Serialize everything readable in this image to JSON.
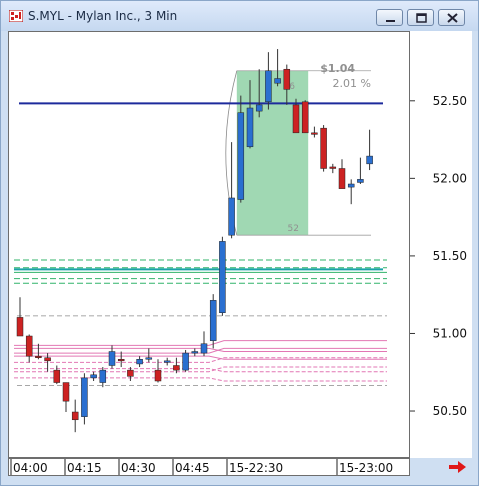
{
  "window": {
    "title": "S.MYL - Mylan Inc., 3 Min",
    "buttons": {
      "minimize": "minimize-icon",
      "restore": "restore-icon",
      "close": "close-icon"
    }
  },
  "colors": {
    "up_candle": "#2a6fd0",
    "down_candle": "#cc2222",
    "horizontal_line": "#1d2a9c",
    "measure_box": "#8fd1a6",
    "green_band": "#31b36a",
    "teal_line": "#1aa3a8",
    "pink_band": "#e277b4",
    "gray_dash": "#8a8a8a"
  },
  "measure": {
    "change": "$1.04",
    "percent": "2.01 %",
    "top_bars": "56",
    "bottom_bars": "52"
  },
  "nav": {
    "icon": "right-arrow-icon"
  },
  "chart_data": {
    "type": "candlestick",
    "y_ticks": [
      "52.50",
      "52.00",
      "51.50",
      "51.00",
      "50.50"
    ],
    "ylim": [
      50.21,
      52.95
    ],
    "x_ticks": [
      "04:00",
      "04:15",
      "04:30",
      "04:45",
      "15-22:30",
      "15-23:00"
    ],
    "candles": [
      {
        "o": 51.11,
        "h": 51.24,
        "l": 51.0,
        "c": 50.99
      },
      {
        "o": 50.99,
        "h": 51.0,
        "l": 50.82,
        "c": 50.86
      },
      {
        "o": 50.86,
        "h": 50.94,
        "l": 50.84,
        "c": 50.85
      },
      {
        "o": 50.85,
        "h": 50.88,
        "l": 50.76,
        "c": 50.83
      },
      {
        "o": 50.77,
        "h": 50.8,
        "l": 50.68,
        "c": 50.69
      },
      {
        "o": 50.69,
        "h": 50.69,
        "l": 50.5,
        "c": 50.57
      },
      {
        "o": 50.5,
        "h": 50.58,
        "l": 50.37,
        "c": 50.45
      },
      {
        "o": 50.47,
        "h": 50.75,
        "l": 50.42,
        "c": 50.72
      },
      {
        "o": 50.72,
        "h": 50.76,
        "l": 50.7,
        "c": 50.74
      },
      {
        "o": 50.69,
        "h": 50.79,
        "l": 50.66,
        "c": 50.77
      },
      {
        "o": 50.8,
        "h": 50.93,
        "l": 50.78,
        "c": 50.89
      },
      {
        "o": 50.84,
        "h": 50.89,
        "l": 50.79,
        "c": 50.83
      },
      {
        "o": 50.77,
        "h": 50.79,
        "l": 50.7,
        "c": 50.73
      },
      {
        "o": 50.81,
        "h": 50.86,
        "l": 50.79,
        "c": 50.84
      },
      {
        "o": 50.84,
        "h": 50.91,
        "l": 50.82,
        "c": 50.85
      },
      {
        "o": 50.77,
        "h": 50.84,
        "l": 50.69,
        "c": 50.7
      },
      {
        "o": 50.82,
        "h": 50.85,
        "l": 50.8,
        "c": 50.83
      },
      {
        "o": 50.8,
        "h": 50.85,
        "l": 50.75,
        "c": 50.77
      },
      {
        "o": 50.77,
        "h": 50.9,
        "l": 50.76,
        "c": 50.88
      },
      {
        "o": 50.88,
        "h": 50.91,
        "l": 50.86,
        "c": 50.89
      },
      {
        "o": 50.88,
        "h": 51.02,
        "l": 50.86,
        "c": 50.94
      },
      {
        "o": 50.96,
        "h": 51.26,
        "l": 50.91,
        "c": 51.22
      },
      {
        "o": 51.14,
        "h": 51.63,
        "l": 51.12,
        "c": 51.6
      },
      {
        "o": 51.64,
        "h": 52.24,
        "l": 51.62,
        "c": 51.88
      },
      {
        "o": 51.87,
        "h": 52.54,
        "l": 51.85,
        "c": 52.43
      },
      {
        "o": 52.21,
        "h": 52.64,
        "l": 52.2,
        "c": 52.46
      },
      {
        "o": 52.44,
        "h": 52.71,
        "l": 52.4,
        "c": 52.48
      },
      {
        "o": 52.5,
        "h": 52.82,
        "l": 52.45,
        "c": 52.7
      },
      {
        "o": 52.62,
        "h": 52.84,
        "l": 52.6,
        "c": 52.65
      },
      {
        "o": 52.71,
        "h": 52.74,
        "l": 52.48,
        "c": 52.58
      },
      {
        "o": 52.48,
        "h": 52.52,
        "l": 52.44,
        "c": 52.3
      },
      {
        "o": 52.5,
        "h": 52.51,
        "l": 52.3,
        "c": 52.3
      },
      {
        "o": 52.3,
        "h": 52.34,
        "l": 52.27,
        "c": 52.29
      },
      {
        "o": 52.33,
        "h": 52.35,
        "l": 52.05,
        "c": 52.07
      },
      {
        "o": 52.08,
        "h": 52.1,
        "l": 52.04,
        "c": 52.07
      },
      {
        "o": 52.07,
        "h": 52.13,
        "l": 51.97,
        "c": 51.94
      },
      {
        "o": 51.95,
        "h": 52.0,
        "l": 51.84,
        "c": 51.97
      },
      {
        "o": 51.98,
        "h": 52.14,
        "l": 51.97,
        "c": 52.0
      },
      {
        "o": 52.1,
        "h": 52.32,
        "l": 52.06,
        "c": 52.15
      }
    ],
    "horizontal_line": 52.49,
    "green_band_lines": [
      51.48,
      51.43,
      51.4,
      51.36,
      51.33
    ],
    "teal_line": 51.42,
    "gray_dashed": [
      51.12,
      50.67
    ],
    "pink_band_lines": [
      50.93,
      50.91,
      50.88,
      50.86,
      50.82,
      50.78,
      50.76,
      50.72
    ]
  }
}
